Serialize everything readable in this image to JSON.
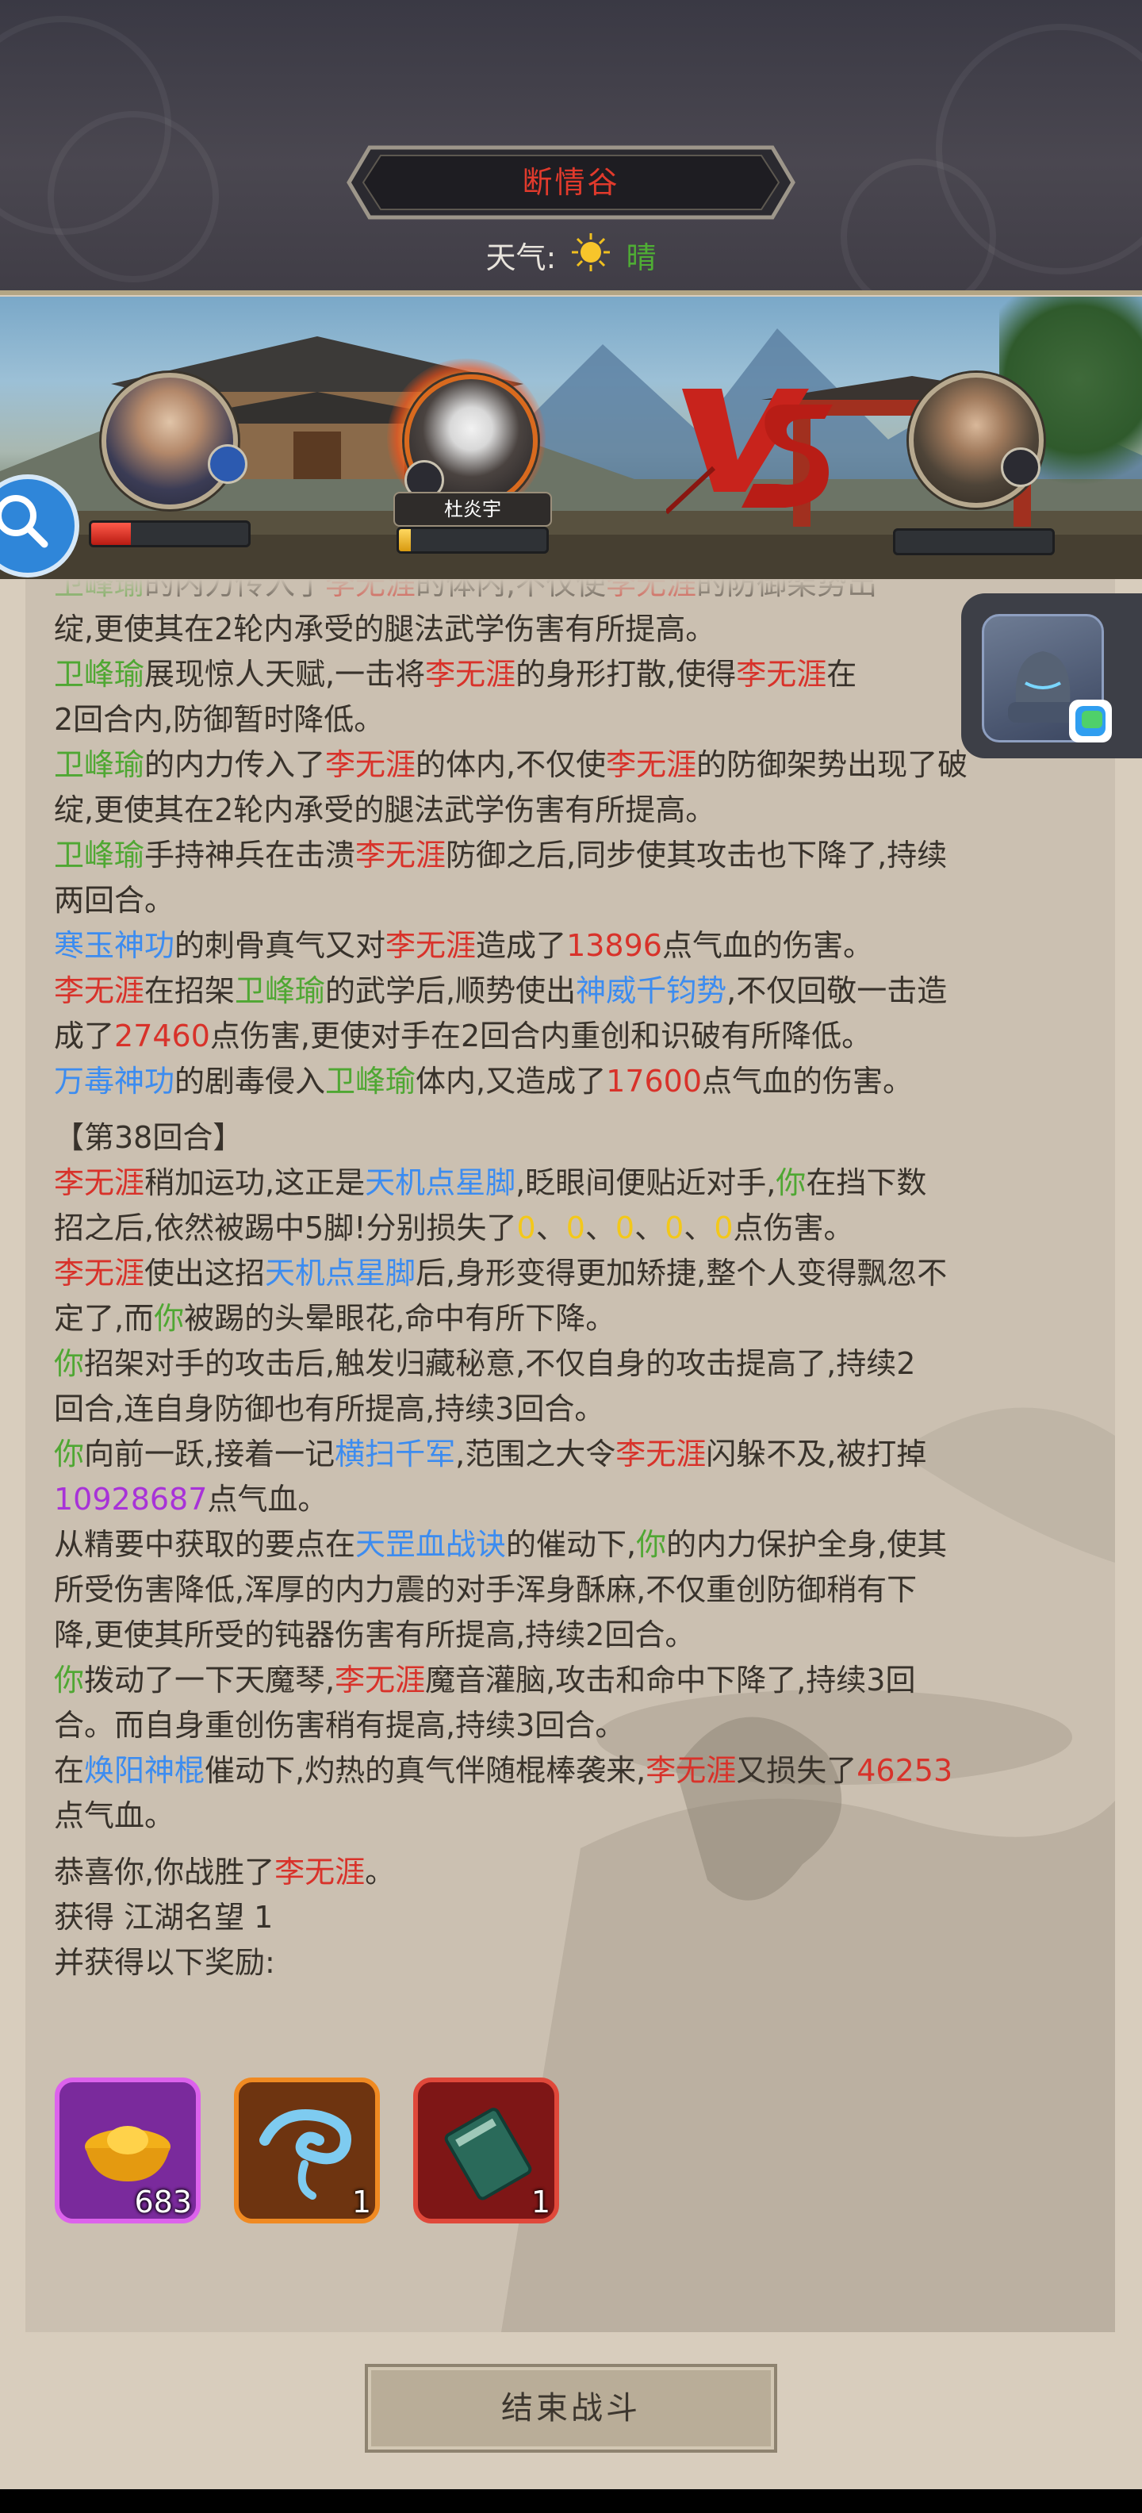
{
  "header": {
    "location": "断情谷",
    "weather_label": "天气:",
    "weather_icon": "sun-icon",
    "weather_value": "晴"
  },
  "banner": {
    "vs_text": "VS",
    "active_fighter_name": "杜炎宇"
  },
  "log": {
    "lines": [
      {
        "segments": [
          {
            "t": "卫峰瑜",
            "c": "green"
          },
          {
            "t": "的内力传入了"
          },
          {
            "t": "李无涯",
            "c": "red"
          },
          {
            "t": "的体内,不仅使"
          },
          {
            "t": "李无涯",
            "c": "red"
          },
          {
            "t": "的防御架势出"
          }
        ]
      },
      {
        "segments": [
          {
            "t": "绽,更使其在2轮内承受的腿法武学伤害有所提高。"
          }
        ]
      },
      {
        "segments": [
          {
            "t": "卫峰瑜",
            "c": "green"
          },
          {
            "t": "展现惊人天赋,一击将"
          },
          {
            "t": "李无涯",
            "c": "red"
          },
          {
            "t": "的身形打散,使得"
          },
          {
            "t": "李无涯",
            "c": "red"
          },
          {
            "t": "在"
          }
        ]
      },
      {
        "segments": [
          {
            "t": "2回合内,防御暂时降低。"
          }
        ]
      },
      {
        "segments": [
          {
            "t": "卫峰瑜",
            "c": "green"
          },
          {
            "t": "的内力传入了"
          },
          {
            "t": "李无涯",
            "c": "red"
          },
          {
            "t": "的体内,不仅使"
          },
          {
            "t": "李无涯",
            "c": "red"
          },
          {
            "t": "的防御架势出现了破"
          }
        ]
      },
      {
        "segments": [
          {
            "t": "绽,更使其在2轮内承受的腿法武学伤害有所提高。"
          }
        ]
      },
      {
        "segments": [
          {
            "t": "卫峰瑜",
            "c": "green"
          },
          {
            "t": "手持神兵在击溃"
          },
          {
            "t": "李无涯",
            "c": "red"
          },
          {
            "t": "防御之后,同步使其攻击也下降了,持续"
          }
        ]
      },
      {
        "segments": [
          {
            "t": "两回合。"
          }
        ]
      },
      {
        "segments": [
          {
            "t": "寒玉神功",
            "c": "blue"
          },
          {
            "t": "的刺骨真气又对"
          },
          {
            "t": "李无涯",
            "c": "red"
          },
          {
            "t": "造成了"
          },
          {
            "t": "13896",
            "c": "red"
          },
          {
            "t": "点气血的伤害。"
          }
        ]
      },
      {
        "segments": [
          {
            "t": "李无涯",
            "c": "red"
          },
          {
            "t": "在招架"
          },
          {
            "t": "卫峰瑜",
            "c": "green"
          },
          {
            "t": "的武学后,顺势使出"
          },
          {
            "t": "神威千钧势",
            "c": "blue"
          },
          {
            "t": ",不仅回敬一击造"
          }
        ]
      },
      {
        "segments": [
          {
            "t": "成了"
          },
          {
            "t": "27460",
            "c": "red"
          },
          {
            "t": "点伤害,更使对手在2回合内重创和识破有所降低。"
          }
        ]
      },
      {
        "segments": [
          {
            "t": "万毒神功",
            "c": "blue"
          },
          {
            "t": "的剧毒侵入"
          },
          {
            "t": "卫峰瑜",
            "c": "green"
          },
          {
            "t": "体内,又造成了"
          },
          {
            "t": "17600",
            "c": "red"
          },
          {
            "t": "点气血的伤害。"
          }
        ]
      },
      {
        "gap": true
      },
      {
        "segments": [
          {
            "t": "【第38回合】"
          }
        ]
      },
      {
        "segments": [
          {
            "t": "李无涯",
            "c": "red"
          },
          {
            "t": "稍加运功,这正是"
          },
          {
            "t": "天机点星脚",
            "c": "blue"
          },
          {
            "t": ",眨眼间便贴近对手,"
          },
          {
            "t": "你",
            "c": "green"
          },
          {
            "t": "在挡下数"
          }
        ]
      },
      {
        "segments": [
          {
            "t": "招之后,依然被踢中5脚!分别损失了"
          },
          {
            "t": "0",
            "c": "yellow"
          },
          {
            "t": "、"
          },
          {
            "t": "0",
            "c": "yellow"
          },
          {
            "t": "、"
          },
          {
            "t": "0",
            "c": "yellow"
          },
          {
            "t": "、"
          },
          {
            "t": "0",
            "c": "yellow"
          },
          {
            "t": "、"
          },
          {
            "t": "0",
            "c": "yellow"
          },
          {
            "t": "点伤害。"
          }
        ]
      },
      {
        "segments": [
          {
            "t": "李无涯",
            "c": "red"
          },
          {
            "t": "使出这招"
          },
          {
            "t": "天机点星脚",
            "c": "blue"
          },
          {
            "t": "后,身形变得更加矫捷,整个人变得飘忽不"
          }
        ]
      },
      {
        "segments": [
          {
            "t": "定了,而"
          },
          {
            "t": "你",
            "c": "green"
          },
          {
            "t": "被踢的头晕眼花,命中有所下降。"
          }
        ]
      },
      {
        "segments": [
          {
            "t": "你",
            "c": "green"
          },
          {
            "t": "招架对手的攻击后,触发归藏秘意,不仅自身的攻击提高了,持续2"
          }
        ]
      },
      {
        "segments": [
          {
            "t": "回合,连自身防御也有所提高,持续3回合。"
          }
        ]
      },
      {
        "segments": [
          {
            "t": "你",
            "c": "green"
          },
          {
            "t": "向前一跃,接着一记"
          },
          {
            "t": "横扫千军",
            "c": "blue"
          },
          {
            "t": ",范围之大令"
          },
          {
            "t": "李无涯",
            "c": "red"
          },
          {
            "t": "闪躲不及,被打掉"
          }
        ]
      },
      {
        "segments": [
          {
            "t": "10928687",
            "c": "purple"
          },
          {
            "t": "点气血。"
          }
        ]
      },
      {
        "segments": [
          {
            "t": "从精要中获取的要点在"
          },
          {
            "t": "天罡血战诀",
            "c": "blue"
          },
          {
            "t": "的催动下,"
          },
          {
            "t": "你",
            "c": "green"
          },
          {
            "t": "的内力保护全身,使其"
          }
        ]
      },
      {
        "segments": [
          {
            "t": "所受伤害降低,浑厚的内力震的对手浑身酥麻,不仅重创防御稍有下"
          }
        ]
      },
      {
        "segments": [
          {
            "t": "降,更使其所受的钝器伤害有所提高,持续2回合。"
          }
        ]
      },
      {
        "segments": [
          {
            "t": "你",
            "c": "green"
          },
          {
            "t": "拨动了一下天魔琴,"
          },
          {
            "t": "李无涯",
            "c": "red"
          },
          {
            "t": "魔音灌脑,攻击和命中下降了,持续3回"
          }
        ]
      },
      {
        "segments": [
          {
            "t": "合。而自身重创伤害稍有提高,持续3回合。"
          }
        ]
      },
      {
        "segments": [
          {
            "t": "在"
          },
          {
            "t": "焕阳神棍",
            "c": "blue"
          },
          {
            "t": "催动下,灼热的真气伴随棍棒袭来,"
          },
          {
            "t": "李无涯",
            "c": "red"
          },
          {
            "t": "又损失了"
          },
          {
            "t": "46253",
            "c": "red"
          }
        ]
      },
      {
        "segments": [
          {
            "t": "点气血。"
          }
        ]
      },
      {
        "gap": true
      },
      {
        "segments": [
          {
            "t": "恭喜你,你战胜了"
          },
          {
            "t": "李无涯",
            "c": "red"
          },
          {
            "t": "。"
          }
        ]
      },
      {
        "segments": [
          {
            "t": "获得 江湖名望 1"
          }
        ]
      },
      {
        "segments": [
          {
            "t": "并获得以下奖励:"
          }
        ]
      }
    ]
  },
  "rewards": [
    {
      "icon": "gold-ingot-icon",
      "count": "683",
      "color": "#9b2fc4",
      "border": "#d85ef0"
    },
    {
      "icon": "cloud-swirl-icon",
      "count": "1",
      "color": "#7a3a10",
      "border": "#f08a22"
    },
    {
      "icon": "manual-book-icon",
      "count": "1",
      "color": "#8a1a1a",
      "border": "#e0483a"
    }
  ],
  "end_button_label": "结束战斗"
}
